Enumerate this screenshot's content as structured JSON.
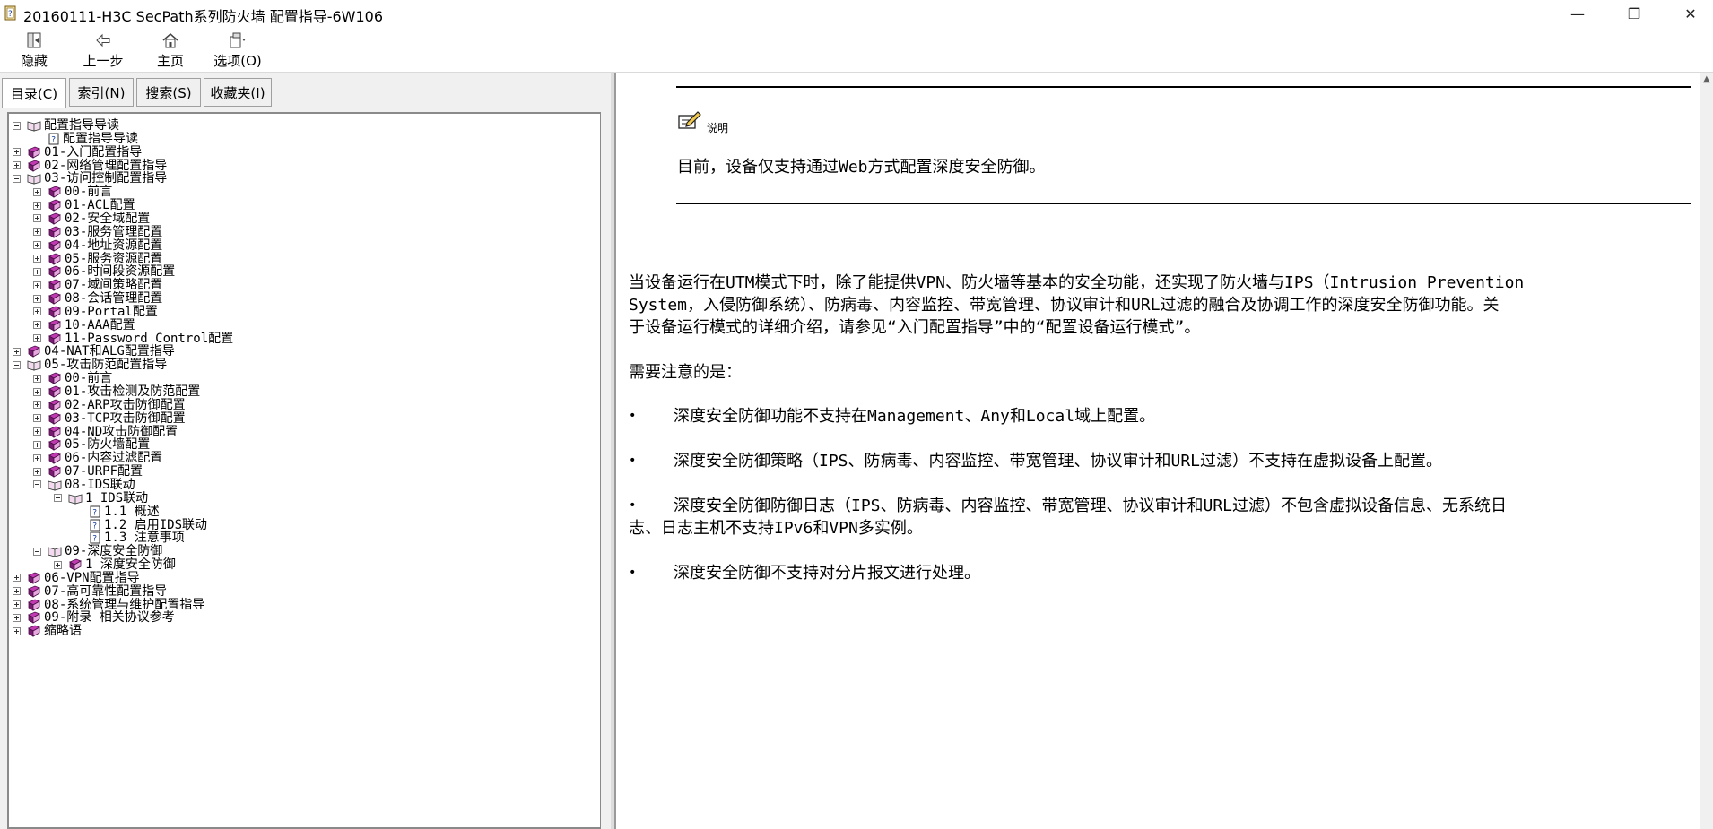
{
  "window": {
    "title": "20160111-H3C SecPath系列防火墙 配置指导-6W106",
    "controls": {
      "minimize": "—",
      "restore": "❐",
      "close": "✕"
    }
  },
  "toolbar": {
    "buttons": [
      {
        "label": "隐藏",
        "icon": "hide-icon"
      },
      {
        "label": "上一步",
        "icon": "back-arrow-icon"
      },
      {
        "label": "主页",
        "icon": "home-icon"
      },
      {
        "label": "选项(O)",
        "icon": "options-icon"
      }
    ]
  },
  "tabs": [
    {
      "label": "目录(C)",
      "active": true
    },
    {
      "label": "索引(N)",
      "active": false
    },
    {
      "label": "搜索(S)",
      "active": false
    },
    {
      "label": "收藏夹(I)",
      "active": false
    }
  ],
  "tree": [
    {
      "level": 0,
      "exp": "minus",
      "icon": "book-open",
      "label": "配置指导导读"
    },
    {
      "level": 1,
      "exp": "none",
      "icon": "page",
      "label": "配置指导导读"
    },
    {
      "level": 0,
      "exp": "plus",
      "icon": "book",
      "label": "01-入门配置指导"
    },
    {
      "level": 0,
      "exp": "plus",
      "icon": "book",
      "label": "02-网络管理配置指导"
    },
    {
      "level": 0,
      "exp": "minus",
      "icon": "book-open",
      "label": "03-访问控制配置指导"
    },
    {
      "level": 1,
      "exp": "plus",
      "icon": "book",
      "label": "00-前言"
    },
    {
      "level": 1,
      "exp": "plus",
      "icon": "book",
      "label": "01-ACL配置"
    },
    {
      "level": 1,
      "exp": "plus",
      "icon": "book",
      "label": "02-安全域配置"
    },
    {
      "level": 1,
      "exp": "plus",
      "icon": "book",
      "label": "03-服务管理配置"
    },
    {
      "level": 1,
      "exp": "plus",
      "icon": "book",
      "label": "04-地址资源配置"
    },
    {
      "level": 1,
      "exp": "plus",
      "icon": "book",
      "label": "05-服务资源配置"
    },
    {
      "level": 1,
      "exp": "plus",
      "icon": "book",
      "label": "06-时间段资源配置"
    },
    {
      "level": 1,
      "exp": "plus",
      "icon": "book",
      "label": "07-域间策略配置"
    },
    {
      "level": 1,
      "exp": "plus",
      "icon": "book",
      "label": "08-会话管理配置"
    },
    {
      "level": 1,
      "exp": "plus",
      "icon": "book",
      "label": "09-Portal配置"
    },
    {
      "level": 1,
      "exp": "plus",
      "icon": "book",
      "label": "10-AAA配置"
    },
    {
      "level": 1,
      "exp": "plus",
      "icon": "book",
      "label": "11-Password Control配置"
    },
    {
      "level": 0,
      "exp": "plus",
      "icon": "book",
      "label": "04-NAT和ALG配置指导"
    },
    {
      "level": 0,
      "exp": "minus",
      "icon": "book-open",
      "label": "05-攻击防范配置指导"
    },
    {
      "level": 1,
      "exp": "plus",
      "icon": "book",
      "label": "00-前言"
    },
    {
      "level": 1,
      "exp": "plus",
      "icon": "book",
      "label": "01-攻击检测及防范配置"
    },
    {
      "level": 1,
      "exp": "plus",
      "icon": "book",
      "label": "02-ARP攻击防御配置"
    },
    {
      "level": 1,
      "exp": "plus",
      "icon": "book",
      "label": "03-TCP攻击防御配置"
    },
    {
      "level": 1,
      "exp": "plus",
      "icon": "book",
      "label": "04-ND攻击防御配置"
    },
    {
      "level": 1,
      "exp": "plus",
      "icon": "book",
      "label": "05-防火墙配置"
    },
    {
      "level": 1,
      "exp": "plus",
      "icon": "book",
      "label": "06-内容过滤配置"
    },
    {
      "level": 1,
      "exp": "plus",
      "icon": "book",
      "label": "07-URPF配置"
    },
    {
      "level": 1,
      "exp": "minus",
      "icon": "book-open",
      "label": "08-IDS联动"
    },
    {
      "level": 2,
      "exp": "minus",
      "icon": "book-open",
      "label": "1 IDS联动"
    },
    {
      "level": 3,
      "exp": "none",
      "icon": "page",
      "label": "1.1  概述"
    },
    {
      "level": 3,
      "exp": "none",
      "icon": "page",
      "label": "1.2  启用IDS联动"
    },
    {
      "level": 3,
      "exp": "none",
      "icon": "page",
      "label": "1.3  注意事项"
    },
    {
      "level": 1,
      "exp": "minus",
      "icon": "book-open",
      "label": "09-深度安全防御"
    },
    {
      "level": 2,
      "exp": "plus",
      "icon": "book",
      "label": "1 深度安全防御"
    },
    {
      "level": 0,
      "exp": "plus",
      "icon": "book",
      "label": "06-VPN配置指导"
    },
    {
      "level": 0,
      "exp": "plus",
      "icon": "book",
      "label": "07-高可靠性配置指导"
    },
    {
      "level": 0,
      "exp": "plus",
      "icon": "book",
      "label": "08-系统管理与维护配置指导"
    },
    {
      "level": 0,
      "exp": "plus",
      "icon": "book",
      "label": "09-附录 相关协议参考"
    },
    {
      "level": 0,
      "exp": "plus",
      "icon": "book",
      "label": "缩略语"
    }
  ],
  "content": {
    "note_label": "说明",
    "note_text": "目前，设备仅支持通过Web方式配置深度安全防御。",
    "para1": [
      "当设备运行在UTM模式下时，除了能提供VPN、防火墙等基本的安全功能，还实现了防火墙与IPS（Intrusion Prevention",
      "System，入侵防御系统）、防病毒、内容监控、带宽管理、协议审计和URL过滤的融合及协调工作的深度安全防御功能。关",
      "于设备运行模式的详细介绍，请参见“入门配置指导”中的“配置设备运行模式”。"
    ],
    "para2": "需要注意的是：",
    "bullets": [
      [
        "深度安全防御功能不支持在Management、Any和Local域上配置。"
      ],
      [
        "深度安全防御策略（IPS、防病毒、内容监控、带宽管理、协议审计和URL过滤）不支持在虚拟设备上配置。"
      ],
      [
        "深度安全防御防御日志（IPS、防病毒、内容监控、带宽管理、协议审计和URL过滤）不包含虚拟设备信息、无系统日",
        "志、日志主机不支持IPv6和VPN多实例。"
      ],
      [
        "深度安全防御不支持对分片报文进行处理。"
      ]
    ],
    "bullet_char": "•"
  }
}
